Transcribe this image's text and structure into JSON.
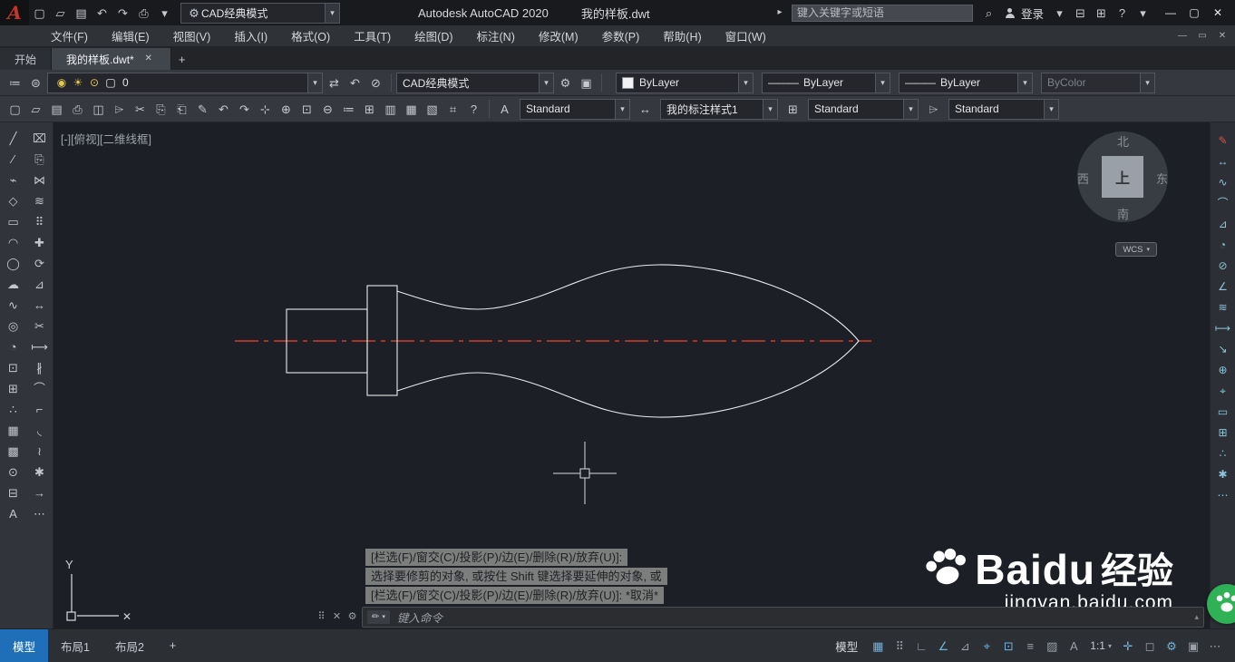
{
  "ui": {
    "arrow": "▾"
  },
  "titlebar": {
    "logo_letter": "A",
    "qat": [
      {
        "name": "new-file-icon",
        "glyph": "▢"
      },
      {
        "name": "open-file-icon",
        "glyph": "▱"
      },
      {
        "name": "save-icon",
        "glyph": "▤"
      },
      {
        "name": "undo-icon",
        "glyph": "↶"
      },
      {
        "name": "redo-icon",
        "glyph": "↷"
      },
      {
        "name": "plot-icon",
        "glyph": "⎙"
      },
      {
        "name": "qat-customize-icon",
        "glyph": "▾"
      }
    ],
    "workspace_gear": "⚙",
    "workspace_value": "CAD经典模式",
    "app_title": "Autodesk AutoCAD 2020",
    "doc_title": "我的样板.dwt",
    "title_arrow": "▸",
    "search_placeholder": "键入关键字或短语",
    "search_icon": "⌕",
    "signin_label": "登录",
    "extra_icons": [
      {
        "name": "signin-arrow-icon",
        "glyph": "▾"
      },
      {
        "name": "app-store-icon",
        "glyph": "⊟"
      },
      {
        "name": "autodesk-apps-icon",
        "glyph": "⊞"
      },
      {
        "name": "help-icon",
        "glyph": "?"
      },
      {
        "name": "help-arrow-icon",
        "glyph": "▾"
      }
    ],
    "window_controls": [
      {
        "name": "minimize-button",
        "glyph": "—"
      },
      {
        "name": "maximize-button",
        "glyph": "▢"
      },
      {
        "name": "close-button",
        "glyph": "✕"
      }
    ]
  },
  "menubar": {
    "items": [
      {
        "name": "menu-file",
        "label": "文件(F)"
      },
      {
        "name": "menu-edit",
        "label": "编辑(E)"
      },
      {
        "name": "menu-view",
        "label": "视图(V)"
      },
      {
        "name": "menu-insert",
        "label": "插入(I)"
      },
      {
        "name": "menu-format",
        "label": "格式(O)"
      },
      {
        "name": "menu-tools",
        "label": "工具(T)"
      },
      {
        "name": "menu-draw",
        "label": "绘图(D)"
      },
      {
        "name": "menu-dimension",
        "label": "标注(N)"
      },
      {
        "name": "menu-modify",
        "label": "修改(M)"
      },
      {
        "name": "menu-parametric",
        "label": "参数(P)"
      },
      {
        "name": "menu-help",
        "label": "帮助(H)"
      },
      {
        "name": "menu-window",
        "label": "窗口(W)"
      }
    ],
    "doc_controls": [
      {
        "name": "doc-minimize-button",
        "glyph": "—"
      },
      {
        "name": "doc-restore-button",
        "glyph": "▭"
      },
      {
        "name": "doc-close-button",
        "glyph": "✕"
      }
    ]
  },
  "filetabs": {
    "start_label": "开始",
    "doc_label": "我的样板.dwt*",
    "close_glyph": "✕",
    "new_tab_glyph": "+"
  },
  "toolbar_layer": {
    "lead_icons": [
      {
        "name": "layer-properties-icon",
        "glyph": "≔"
      },
      {
        "name": "layer-states-icon",
        "glyph": "⊜"
      }
    ],
    "layer_badges": [
      {
        "name": "layer-on-icon",
        "glyph": "◉",
        "color": "#e8c74a"
      },
      {
        "name": "layer-thaw-icon",
        "glyph": "☀",
        "color": "#e8c74a"
      },
      {
        "name": "layer-unlock-icon",
        "glyph": "⊙",
        "color": "#e8c74a"
      },
      {
        "name": "layer-color-swatch",
        "glyph": "▢",
        "color": "#eceff2"
      }
    ],
    "layer_value": "0",
    "trail_icons": [
      {
        "name": "make-current-layer-icon",
        "glyph": "⇄"
      },
      {
        "name": "layer-previous-icon",
        "glyph": "↶"
      },
      {
        "name": "layer-isolate-icon",
        "glyph": "⊘"
      }
    ],
    "workspace_value": "CAD经典模式",
    "after_icons": [
      {
        "name": "workspace-settings-icon",
        "glyph": "⚙"
      },
      {
        "name": "viewport-dialog-icon",
        "glyph": "▣"
      }
    ],
    "color_value": "ByLayer",
    "linetype_sample": "———",
    "linetype_value": "ByLayer",
    "lineweight_sample": "———",
    "lineweight_value": "ByLayer",
    "plotstyle_value": "ByColor"
  },
  "toolbar_std": {
    "icons": [
      {
        "name": "new-icon",
        "glyph": "▢"
      },
      {
        "name": "open-icon",
        "glyph": "▱"
      },
      {
        "name": "save-icon",
        "glyph": "▤"
      },
      {
        "name": "plot-icon",
        "glyph": "⎙"
      },
      {
        "name": "plot-preview-icon",
        "glyph": "◫"
      },
      {
        "name": "publish-icon",
        "glyph": "⌲"
      },
      {
        "name": "cut-icon",
        "glyph": "✂"
      },
      {
        "name": "copy-icon",
        "glyph": "⎘"
      },
      {
        "name": "paste-icon",
        "glyph": "⎗"
      },
      {
        "name": "match-properties-icon",
        "glyph": "✎"
      },
      {
        "name": "undo-icon",
        "glyph": "↶"
      },
      {
        "name": "redo-icon",
        "glyph": "↷"
      },
      {
        "name": "pan-icon",
        "glyph": "⊹"
      },
      {
        "name": "zoom-realtime-icon",
        "glyph": "⊕"
      },
      {
        "name": "zoom-window-icon",
        "glyph": "⊡"
      },
      {
        "name": "zoom-previous-icon",
        "glyph": "⊖"
      },
      {
        "name": "properties-icon",
        "glyph": "≔"
      },
      {
        "name": "designcenter-icon",
        "glyph": "⊞"
      },
      {
        "name": "tool-palettes-icon",
        "glyph": "▥"
      },
      {
        "name": "sheet-set-manager-icon",
        "glyph": "▦"
      },
      {
        "name": "markup-icon",
        "glyph": "▧"
      },
      {
        "name": "quickcalc-icon",
        "glyph": "⌗"
      },
      {
        "name": "help-icon",
        "glyph": "?"
      }
    ],
    "text_style_icon": "A",
    "text_style_label": "Standard",
    "dim_style_icon": "↔",
    "dim_style_label": "我的标注样式1",
    "table_style_icon": "⊞",
    "table_style_label": "Standard",
    "mleader_style_icon": "⌲",
    "mleader_style_label": "Standard"
  },
  "draw_toolbar": [
    {
      "name": "line-icon",
      "glyph": "╱"
    },
    {
      "name": "construction-line-icon",
      "glyph": "∕"
    },
    {
      "name": "polyline-icon",
      "glyph": "⌁"
    },
    {
      "name": "polygon-icon",
      "glyph": "◇"
    },
    {
      "name": "rectangle-icon",
      "glyph": "▭"
    },
    {
      "name": "arc-icon",
      "glyph": "◠"
    },
    {
      "name": "circle-icon",
      "glyph": "◯"
    },
    {
      "name": "revision-cloud-icon",
      "glyph": "☁"
    },
    {
      "name": "spline-icon",
      "glyph": "∿"
    },
    {
      "name": "ellipse-icon",
      "glyph": "◎"
    },
    {
      "name": "ellipse-arc-icon",
      "glyph": "◔"
    },
    {
      "name": "insert-block-icon",
      "glyph": "⊡"
    },
    {
      "name": "make-block-icon",
      "glyph": "⊞"
    },
    {
      "name": "point-icon",
      "glyph": "∴"
    },
    {
      "name": "hatch-icon",
      "glyph": "▦"
    },
    {
      "name": "gradient-icon",
      "glyph": "▩"
    },
    {
      "name": "region-icon",
      "glyph": "⊙"
    },
    {
      "name": "table-icon",
      "glyph": "⊟"
    },
    {
      "name": "mtext-icon",
      "glyph": "A"
    }
  ],
  "modify_toolbar": [
    {
      "name": "erase-icon",
      "glyph": "⌧"
    },
    {
      "name": "copy-icon",
      "glyph": "⎘"
    },
    {
      "name": "mirror-icon",
      "glyph": "⋈"
    },
    {
      "name": "offset-icon",
      "glyph": "≋"
    },
    {
      "name": "array-icon",
      "glyph": "⠿"
    },
    {
      "name": "move-icon",
      "glyph": "✚"
    },
    {
      "name": "rotate-icon",
      "glyph": "⟳"
    },
    {
      "name": "scale-icon",
      "glyph": "⊿"
    },
    {
      "name": "stretch-icon",
      "glyph": "↔"
    },
    {
      "name": "trim-icon",
      "glyph": "✂"
    },
    {
      "name": "extend-icon",
      "glyph": "⟼"
    },
    {
      "name": "break-icon",
      "glyph": "∦"
    },
    {
      "name": "join-icon",
      "glyph": "⌒"
    },
    {
      "name": "chamfer-icon",
      "glyph": "⌐"
    },
    {
      "name": "fillet-icon",
      "glyph": "◟"
    },
    {
      "name": "blend-curves-icon",
      "glyph": "≀"
    },
    {
      "name": "explode-icon",
      "glyph": "✱"
    },
    {
      "name": "lengthen-icon",
      "glyph": "→"
    },
    {
      "name": "more-tools-icon",
      "glyph": "⋯"
    }
  ],
  "right_toolbar": [
    {
      "name": "match-properties-icon",
      "glyph": "✎",
      "color": "#d95448"
    },
    {
      "name": "linear-dimension-icon",
      "glyph": "↔"
    },
    {
      "name": "aligned-dimension-icon",
      "glyph": "∿"
    },
    {
      "name": "arc-length-dimension-icon",
      "glyph": "⌒"
    },
    {
      "name": "ordinate-dimension-icon",
      "glyph": "⊿"
    },
    {
      "name": "radius-dimension-icon",
      "glyph": "◔"
    },
    {
      "name": "diameter-dimension-icon",
      "glyph": "⊘"
    },
    {
      "name": "angular-dimension-icon",
      "glyph": "∠"
    },
    {
      "name": "quick-dimension-icon",
      "glyph": "≋"
    },
    {
      "name": "baseline-dimension-icon",
      "glyph": "⟼"
    },
    {
      "name": "continue-dimension-icon",
      "glyph": "↘"
    },
    {
      "name": "leader-icon",
      "glyph": "⊕"
    },
    {
      "name": "tolerance-icon",
      "glyph": "⌖"
    },
    {
      "name": "center-mark-icon",
      "glyph": "▭"
    },
    {
      "name": "inspection-icon",
      "glyph": "⊞"
    },
    {
      "name": "jogged-dimension-icon",
      "glyph": "∴"
    },
    {
      "name": "dimension-update-icon",
      "glyph": "✱"
    },
    {
      "name": "more-tools-icon",
      "glyph": "⋯"
    }
  ],
  "canvas": {
    "viewport_label": "[-][俯视][二维线框]",
    "compass": {
      "n": "北",
      "w": "西",
      "e": "东",
      "s": "南",
      "center": "上"
    },
    "wcs_label": "WCS",
    "ucs_axis_label": "Y",
    "ucs_x_mark": "✕",
    "watermark": {
      "brand": "Baidu",
      "suffix": "经验",
      "site": "jingyan.baidu.com"
    }
  },
  "command": {
    "history": [
      "[栏选(F)/窗交(C)/投影(P)/边(E)/删除(R)/放弃(U)]:",
      "选择要修剪的对象, 或按住 Shift 键选择要延伸的对象, 或",
      "[栏选(F)/窗交(C)/投影(P)/边(E)/删除(R)/放弃(U)]: *取消*"
    ],
    "dock_icons": [
      {
        "name": "command-grip-icon",
        "glyph": "⠿"
      },
      {
        "name": "command-close-icon",
        "glyph": "✕"
      },
      {
        "name": "command-customize-icon",
        "glyph": "⚙"
      }
    ],
    "prompt_icon": "✏",
    "prompt_arrow": "▾",
    "placeholder": "键入命令",
    "scroll_icon": "▴"
  },
  "statusbar": {
    "tabs": [
      {
        "name": "model-tab",
        "label": "模型",
        "active": true
      },
      {
        "name": "layout1-tab",
        "label": "布局1"
      },
      {
        "name": "layout2-tab",
        "label": "布局2"
      },
      {
        "name": "new-layout-tab",
        "label": "+"
      }
    ],
    "model_label": "模型",
    "icons_left": [
      {
        "name": "grid-icon",
        "glyph": "▦",
        "active": true
      },
      {
        "name": "snap-mode-icon",
        "glyph": "⠿"
      },
      {
        "name": "ortho-icon",
        "glyph": "∟"
      },
      {
        "name": "polar-tracking-icon",
        "glyph": "∠",
        "active": true
      },
      {
        "name": "isodraft-icon",
        "glyph": "⊿"
      },
      {
        "name": "osnap-tracking-icon",
        "glyph": "⌖",
        "active": true
      },
      {
        "name": "object-snap-icon",
        "glyph": "⊡",
        "active": true
      },
      {
        "name": "lineweight-icon",
        "glyph": "≡"
      },
      {
        "name": "transparency-icon",
        "glyph": "▨"
      },
      {
        "name": "annotation-visibility-icon",
        "glyph": "A"
      }
    ],
    "scale_label": "1:1",
    "icons_right": [
      {
        "name": "workspace-switch-icon",
        "glyph": "✛",
        "active": true
      },
      {
        "name": "annotation-monitor-icon",
        "glyph": "◻"
      },
      {
        "name": "hardware-acceleration-icon",
        "glyph": "⚙",
        "active": true
      },
      {
        "name": "isolate-objects-icon",
        "glyph": "▣"
      },
      {
        "name": "customization-icon",
        "glyph": "⋯"
      }
    ]
  }
}
